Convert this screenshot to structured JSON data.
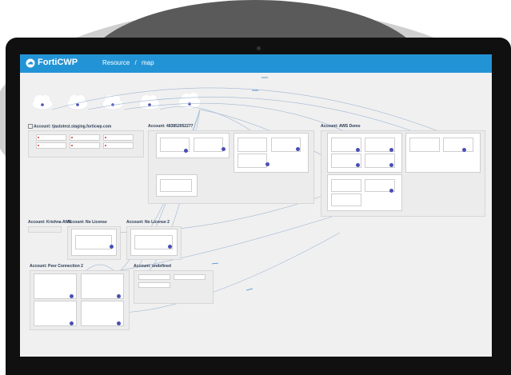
{
  "app": {
    "name": "FortiCWP",
    "brand_color": "#2294d6",
    "breadcrumb": [
      "Resource",
      "/",
      "map"
    ]
  },
  "clouds": [
    {
      "label": ""
    },
    {
      "label": ""
    },
    {
      "label": ""
    },
    {
      "label": ""
    },
    {
      "label": ""
    }
  ],
  "accounts": [
    {
      "title": "Account: tjautotest.staging.forticwp.com"
    },
    {
      "title": "Account: 483852052277"
    },
    {
      "title": "Account: AWS Demo"
    },
    {
      "title": "Account: Krishna AWS"
    },
    {
      "title": "Account: No License"
    },
    {
      "title": "Account: No License 2"
    },
    {
      "title": "Account: Peer Connection 2"
    },
    {
      "title": "Account: undefined"
    }
  ],
  "colors": {
    "header": "#2294d6",
    "node": "#4a4fb5",
    "link": "#7fa9d6",
    "account_title": "#2a3b57"
  }
}
